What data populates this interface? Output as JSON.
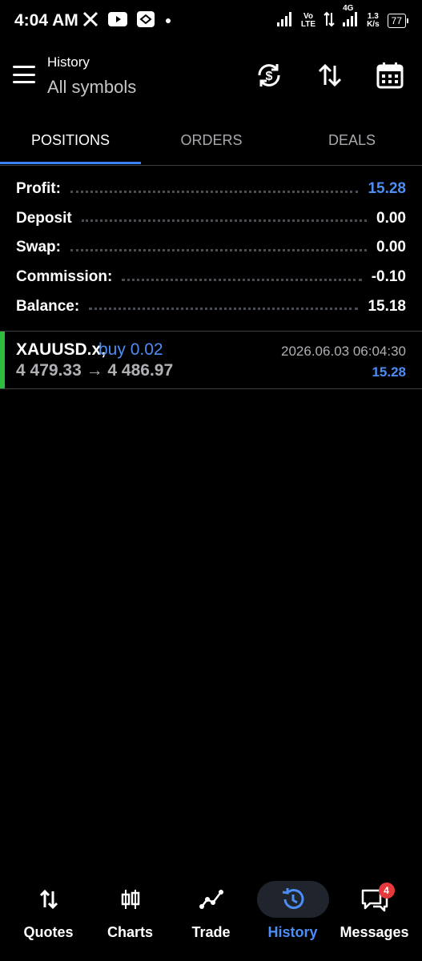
{
  "status_bar": {
    "time": "4:04 AM",
    "icons": [
      "x-icon",
      "youtube-icon",
      "app-icon",
      "dot-icon"
    ],
    "network_label_top": "Vo",
    "network_label_bottom": "LTE",
    "network_4g": "4G",
    "speed_value": "1.3",
    "speed_unit": "K/s",
    "battery": "77"
  },
  "header": {
    "subtitle": "History",
    "title": "All symbols",
    "actions": [
      "sync-currency-icon",
      "sort-icon",
      "calendar-icon"
    ]
  },
  "tabs": [
    {
      "label": "POSITIONS",
      "active": true
    },
    {
      "label": "ORDERS",
      "active": false
    },
    {
      "label": "DEALS",
      "active": false
    }
  ],
  "summary": [
    {
      "label": "Profit:",
      "value": "15.28",
      "highlight": true
    },
    {
      "label": "Deposit",
      "value": "0.00",
      "highlight": false
    },
    {
      "label": "Swap:",
      "value": "0.00",
      "highlight": false
    },
    {
      "label": "Commission:",
      "value": "-0.10",
      "highlight": false
    },
    {
      "label": "Balance:",
      "value": "15.18",
      "highlight": false
    }
  ],
  "position": {
    "symbol": "XAUUSD.x,",
    "side": "buy 0.02",
    "prices": "4 479.33 → 4 486.97",
    "datetime": "2026.06.03 06:04:30",
    "profit": "15.28",
    "status_color": "#2ebd3d"
  },
  "bottom_nav": [
    {
      "label": "Quotes",
      "icon": "quotes-icon",
      "active": false
    },
    {
      "label": "Charts",
      "icon": "candlestick-icon",
      "active": false
    },
    {
      "label": "Trade",
      "icon": "trade-icon",
      "active": false
    },
    {
      "label": "History",
      "icon": "history-icon",
      "active": true
    },
    {
      "label": "Messages",
      "icon": "messages-icon",
      "active": false,
      "badge": "4"
    }
  ],
  "colors": {
    "accent": "#4c8df6",
    "background": "#000000",
    "buy": "#2ebd3d",
    "badge": "#e5393c"
  }
}
